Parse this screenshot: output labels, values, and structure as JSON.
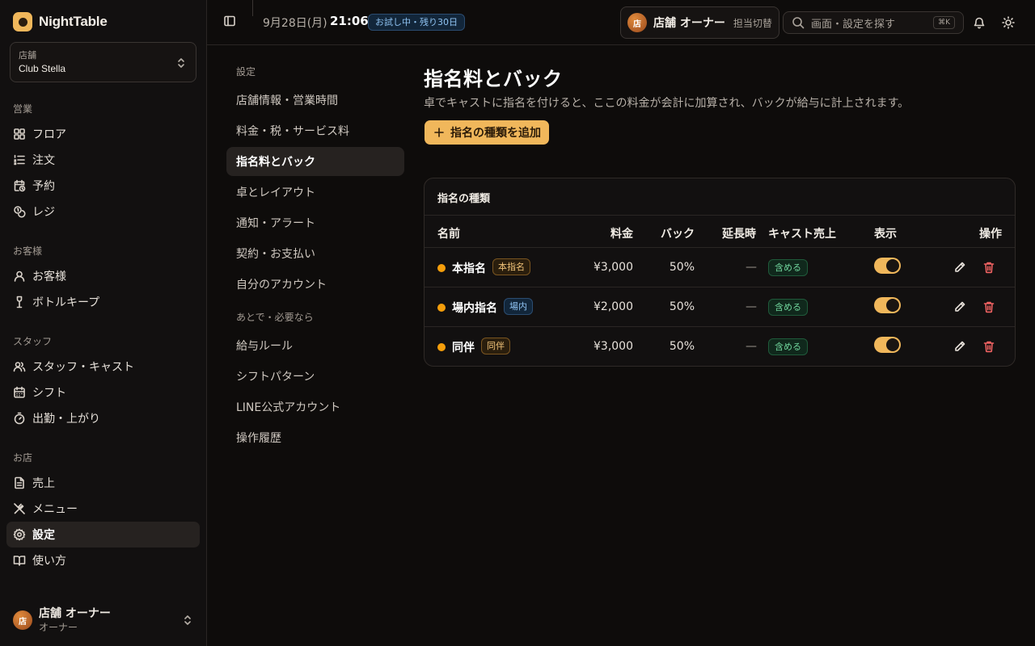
{
  "brand": {
    "name": "NightTable"
  },
  "store": {
    "label": "店舗",
    "value": "Club Stella"
  },
  "nav": {
    "groups": [
      {
        "title": "営業",
        "items": [
          "フロア",
          "注文",
          "予約",
          "レジ"
        ]
      },
      {
        "title": "お客様",
        "items": [
          "お客様",
          "ボトルキープ"
        ]
      },
      {
        "title": "スタッフ",
        "items": [
          "スタッフ・キャスト",
          "シフト",
          "出勤・上がり"
        ]
      },
      {
        "title": "お店",
        "items": [
          "売上",
          "メニュー",
          "設定",
          "使い方"
        ]
      }
    ],
    "active": "設定"
  },
  "user": {
    "avatar": "店",
    "name": "店舗 オーナー",
    "role": "オーナー"
  },
  "topbar": {
    "date": "9月28日(月)",
    "time": "21:06",
    "trial": "お試し中・残り30日",
    "owner_avatar": "店",
    "owner_name": "店舗 オーナー",
    "switch_label": "担当切替",
    "search_placeholder": "画面・設定を探す",
    "search_shortcut": "⌘K"
  },
  "subnav": {
    "title1": "設定",
    "items1": [
      "店舗情報・営業時間",
      "料金・税・サービス料",
      "指名料とバック",
      "卓とレイアウト",
      "通知・アラート",
      "契約・お支払い",
      "自分のアカウント"
    ],
    "title2": "あとで・必要なら",
    "items2": [
      "給与ルール",
      "シフトパターン",
      "LINE公式アカウント",
      "操作履歴"
    ],
    "active": "指名料とバック"
  },
  "page": {
    "title": "指名料とバック",
    "description": "卓でキャストに指名を付けると、ここの料金が会計に加算され、バックが給与に計上されます。",
    "add_button": "指名の種類を追加"
  },
  "table": {
    "title": "指名の種類",
    "columns": {
      "name": "名前",
      "fee": "料金",
      "back": "バック",
      "extension": "延長時",
      "cast_sales": "キャスト売上",
      "visible": "表示",
      "actions": "操作"
    },
    "rows": [
      {
        "name": "本指名",
        "tag": "本指名",
        "tag_color": "amber",
        "fee": "¥3,000",
        "back": "50%",
        "extension": "—",
        "cast_sales": "含める",
        "visible": true
      },
      {
        "name": "場内指名",
        "tag": "場内",
        "tag_color": "blue",
        "fee": "¥2,000",
        "back": "50%",
        "extension": "—",
        "cast_sales": "含める",
        "visible": true
      },
      {
        "name": "同伴",
        "tag": "同伴",
        "tag_color": "amber",
        "fee": "¥3,000",
        "back": "50%",
        "extension": "—",
        "cast_sales": "含める",
        "visible": true
      }
    ]
  },
  "colors": {
    "accent": "#f0b75b",
    "background": "#0e0c0b",
    "dot": "#f59e0b",
    "danger": "#f06262",
    "include": "#6fd39b"
  }
}
